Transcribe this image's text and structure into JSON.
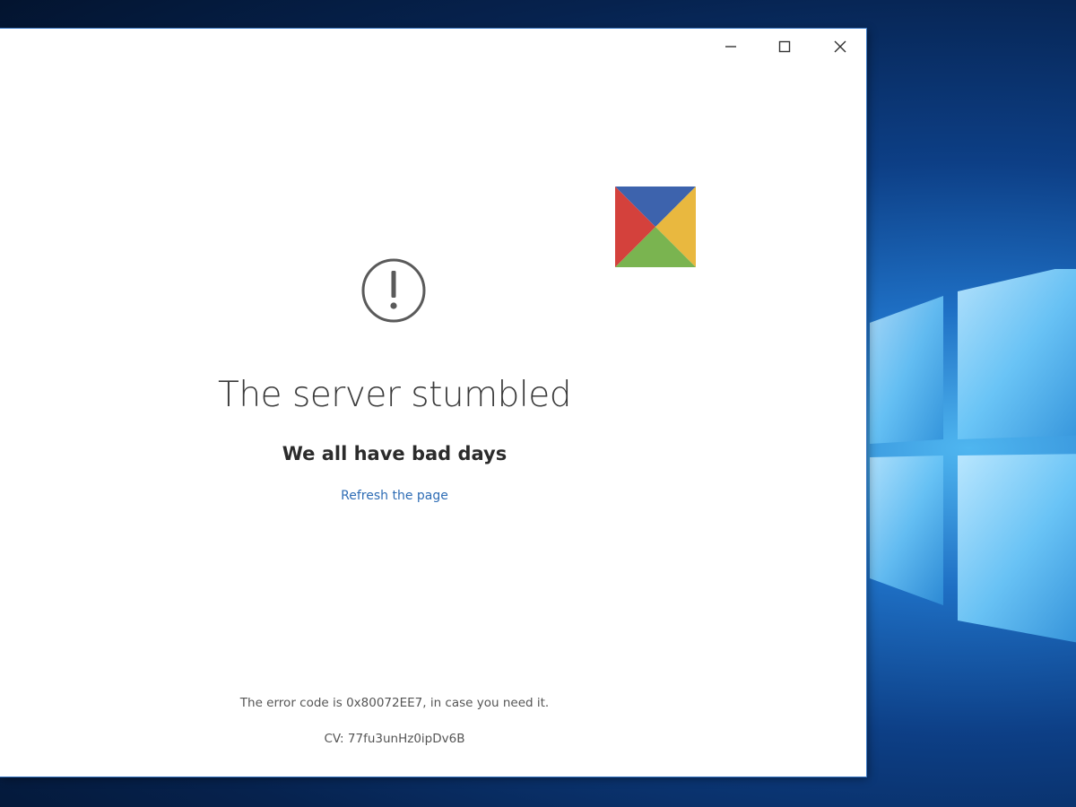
{
  "window": {
    "controls": {
      "minimize_icon": "minimize-icon",
      "maximize_icon": "maximize-icon",
      "close_icon": "close-icon"
    }
  },
  "error_page": {
    "icon": "exclamation-circle-icon",
    "title": "The server stumbled",
    "subtitle": "We all have bad days",
    "refresh_link": "Refresh the page",
    "error_code_text": "The error code is 0x80072EE7, in case you need it.",
    "cv_text": "CV: 77fu3unHz0ipDv6B"
  },
  "colors": {
    "link": "#2f6db5",
    "logo_blue": "#3d63ad",
    "logo_yellow": "#e9b83f",
    "logo_green": "#7ab450",
    "logo_red": "#d4413c"
  }
}
